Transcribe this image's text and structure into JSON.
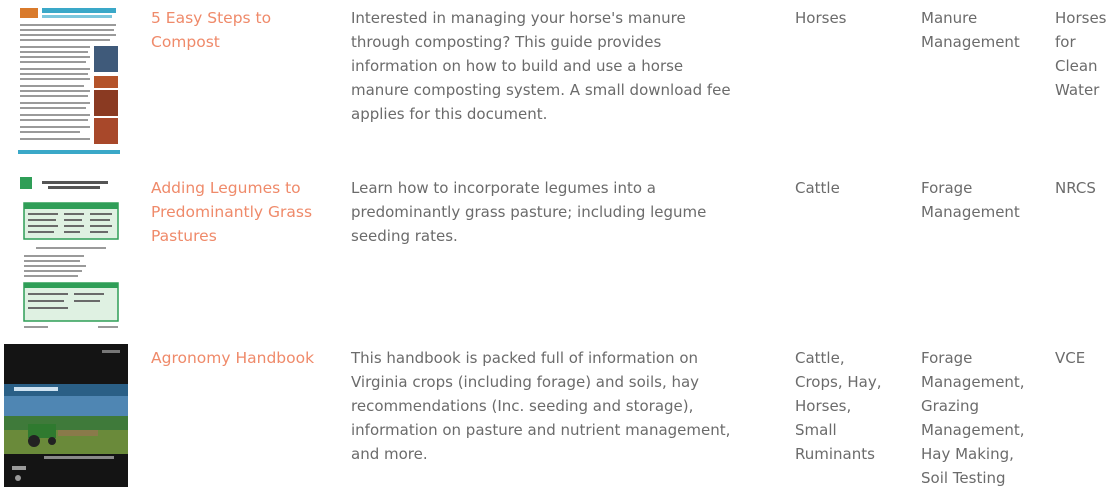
{
  "rows": [
    {
      "title_lines": [
        "5 Easy Steps to",
        "Compost"
      ],
      "desc_lines": [
        "Interested in managing your horse's manure",
        "through composting? This guide provides",
        "information on how to build and use a horse",
        "manure composting system. A small download fee",
        "applies for this document."
      ],
      "species_lines": [
        "Horses"
      ],
      "topic_lines": [
        "Manure",
        "Management"
      ],
      "source_lines": [
        "Horses",
        "for",
        "Clean",
        "Water"
      ],
      "thumb": {
        "heading": "5 Easy Steps to Compost",
        "accent": "#3aa8c8"
      }
    },
    {
      "title_lines": [
        "Adding Legumes to",
        "Predominantly Grass",
        "Pastures"
      ],
      "desc_lines": [
        "Learn how to incorporate legumes into a",
        "predominantly grass pasture; including legume",
        "seeding rates."
      ],
      "species_lines": [
        "Cattle"
      ],
      "topic_lines": [
        "Forage",
        "Management"
      ],
      "source_lines": [
        "NRCS"
      ],
      "thumb": {
        "heading": "Adding Legumes to Predominantly Grass Pastures",
        "accent": "#2f9e57"
      }
    },
    {
      "title_lines": [
        "Agronomy Handbook"
      ],
      "desc_lines": [
        "This handbook is packed full of information on",
        "Virginia crops (including forage) and soils, hay",
        "recommendations (Inc. seeding and storage),",
        "information on pasture and nutrient management,",
        "and more."
      ],
      "species_lines": [
        "Cattle,",
        "Crops, Hay,",
        "Horses,",
        "Small",
        "Ruminants"
      ],
      "topic_lines": [
        "Forage",
        "Management,",
        "Grazing",
        "Management,",
        "Hay Making,",
        "Soil Testing"
      ],
      "source_lines": [
        "VCE"
      ],
      "thumb": {
        "heading": "Agronomy Handbook",
        "accent": "#1f1f1f"
      }
    }
  ],
  "colors": {
    "link": "#ef8a6a",
    "text": "#6b6b6b"
  }
}
